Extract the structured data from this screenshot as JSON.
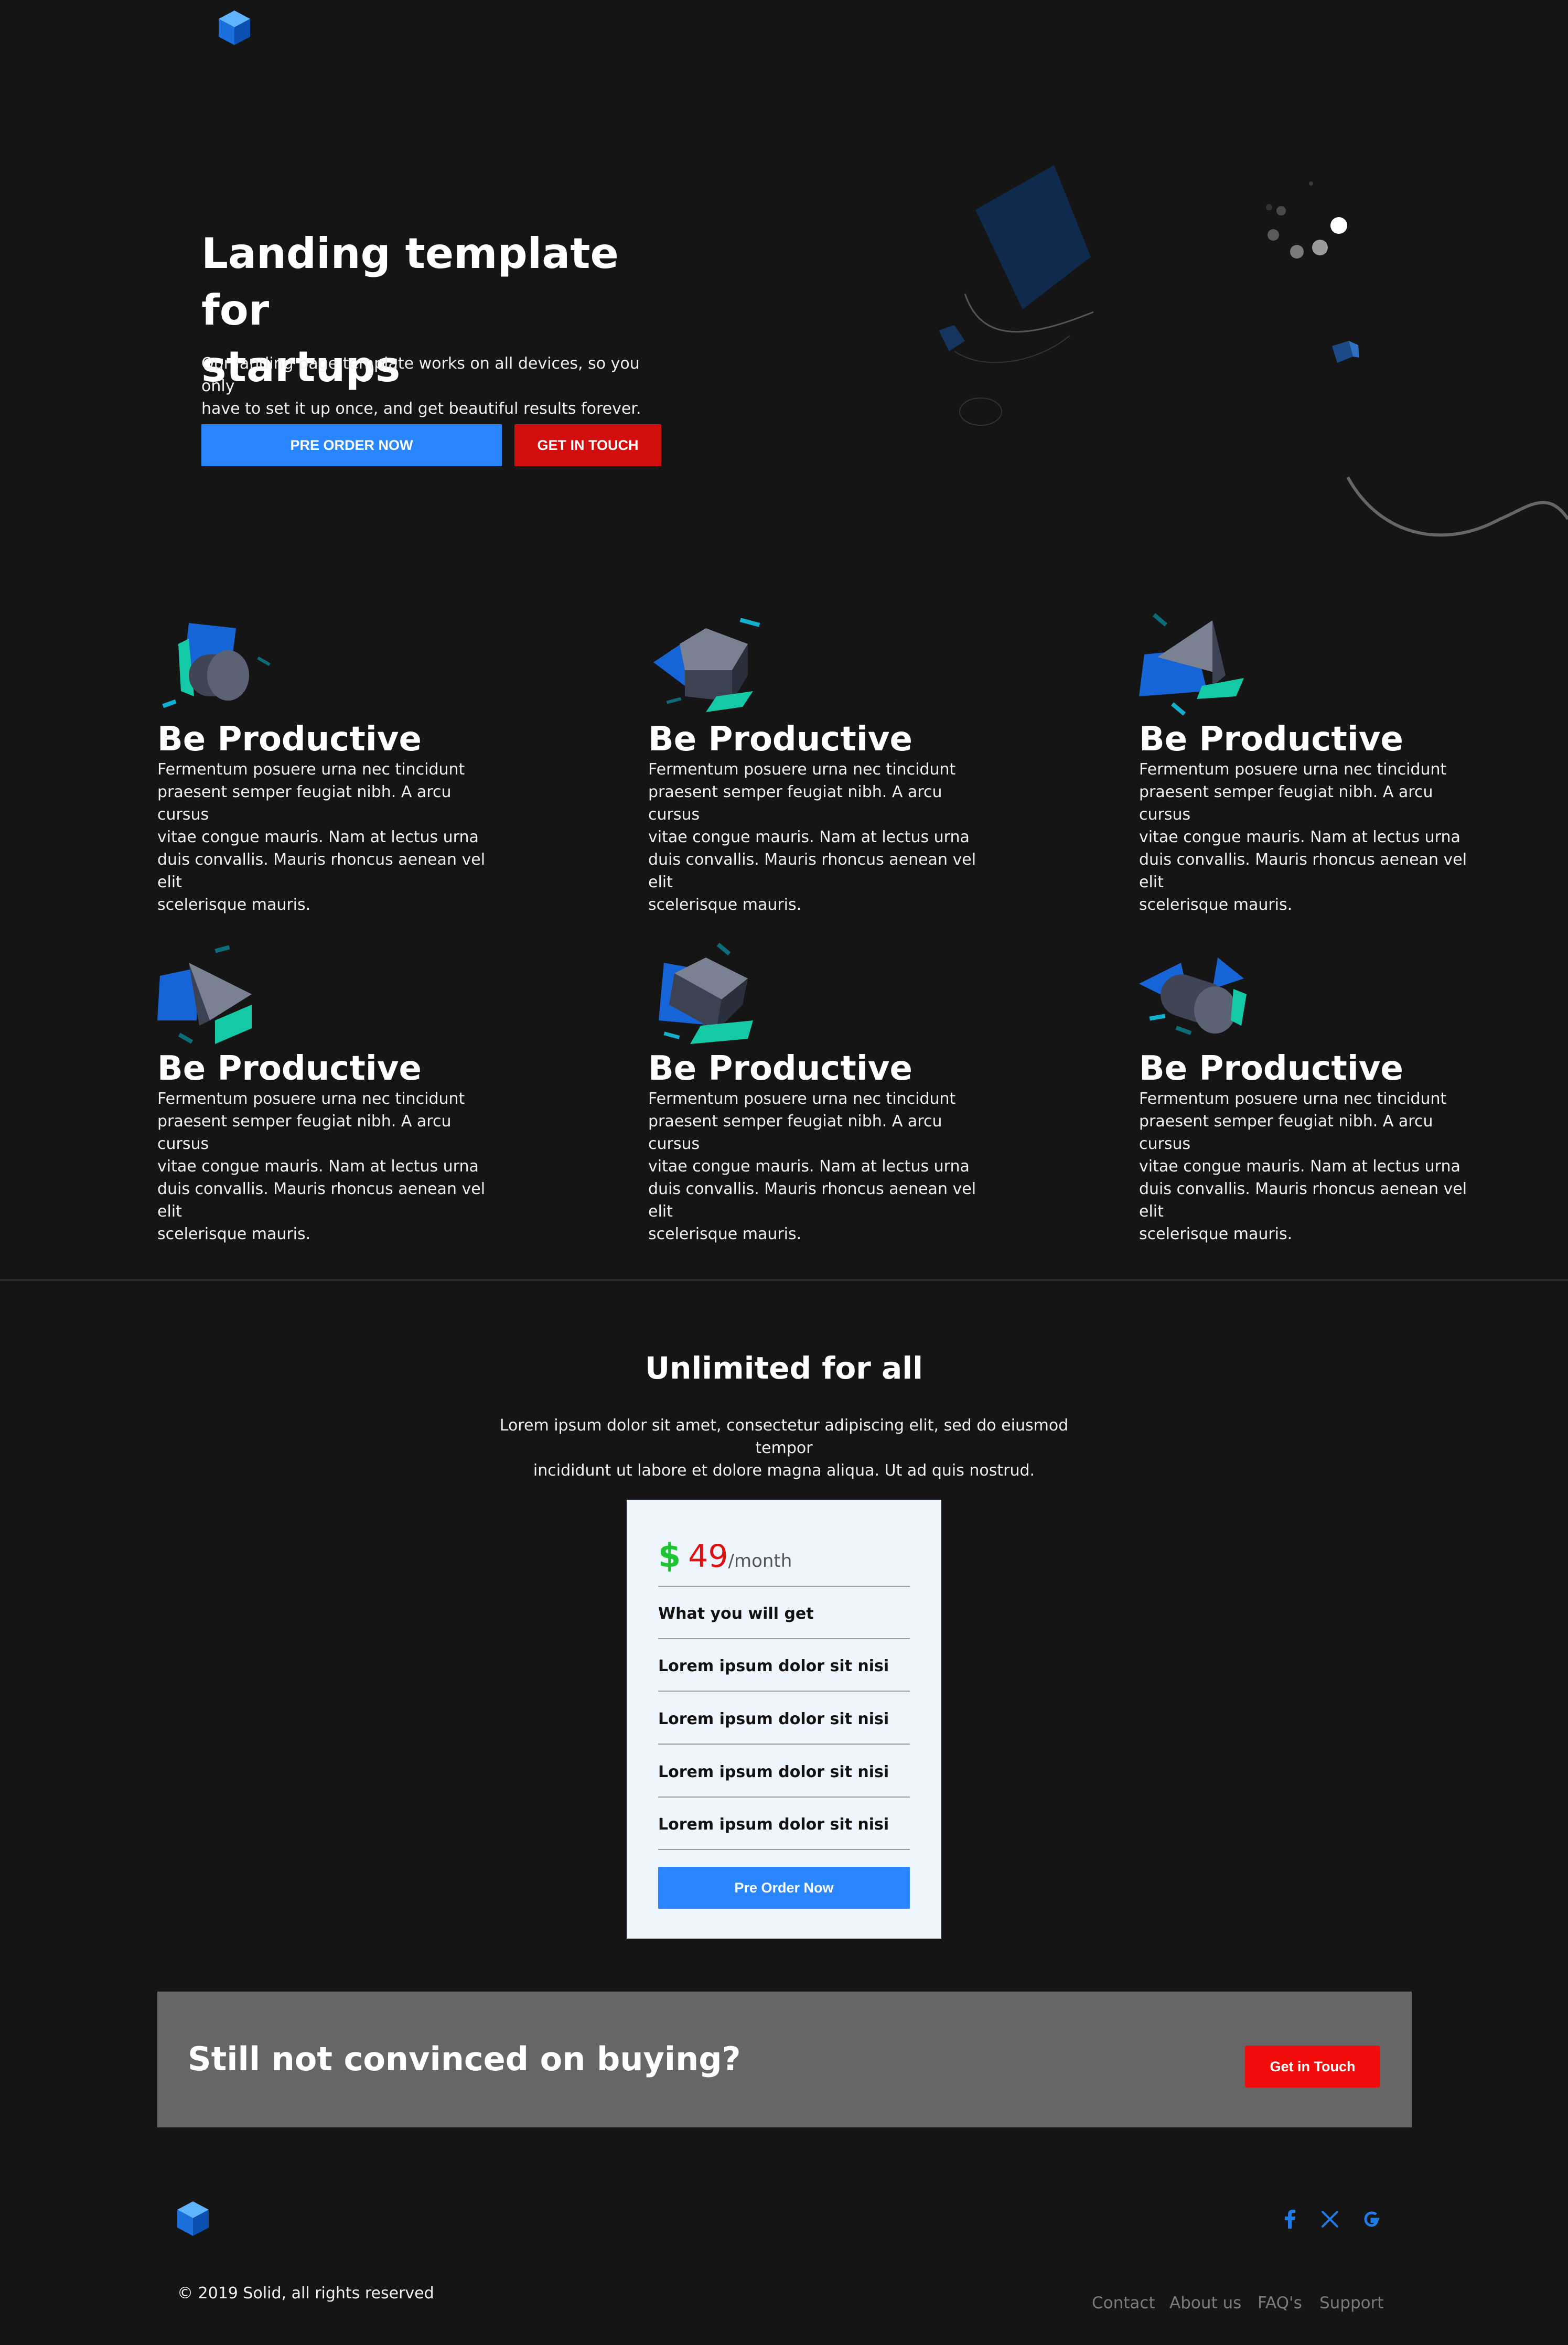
{
  "hero": {
    "title_line1": "Landing template for",
    "title_line2": "startups",
    "desc_line1": "Our landing page template works on all devices, so you only",
    "desc_line2": "have to set it up once, and get beautiful results forever.",
    "preorder_label": "PRE ORDER NOW",
    "touch_label": "GET IN TOUCH"
  },
  "features": [
    {
      "title": "Be Productive",
      "lines": [
        "Fermentum posuere urna nec tincidunt",
        "praesent semper feugiat nibh. A arcu cursus",
        "vitae congue mauris. Nam at lectus urna",
        "duis convallis. Mauris rhoncus aenean vel elit",
        "scelerisque mauris."
      ],
      "icon": "cylinder-icon"
    },
    {
      "title": "Be Productive",
      "lines": [
        "Fermentum posuere urna nec tincidunt",
        "praesent semper feugiat nibh. A arcu cursus",
        "vitae congue mauris. Nam at lectus urna",
        "duis convallis. Mauris rhoncus aenean vel elit",
        "scelerisque mauris."
      ],
      "icon": "cube-icon"
    },
    {
      "title": "Be Productive",
      "lines": [
        "Fermentum posuere urna nec tincidunt",
        "praesent semper feugiat nibh. A arcu cursus",
        "vitae congue mauris. Nam at lectus urna",
        "duis convallis. Mauris rhoncus aenean vel elit",
        "scelerisque mauris."
      ],
      "icon": "cone-icon"
    },
    {
      "title": "Be Productive",
      "lines": [
        "Fermentum posuere urna nec tincidunt",
        "praesent semper feugiat nibh. A arcu cursus",
        "vitae congue mauris. Nam at lectus urna",
        "duis convallis. Mauris rhoncus aenean vel elit",
        "scelerisque mauris."
      ],
      "icon": "pyramid-icon"
    },
    {
      "title": "Be Productive",
      "lines": [
        "Fermentum posuere urna nec tincidunt",
        "praesent semper feugiat nibh. A arcu cursus",
        "vitae congue mauris. Nam at lectus urna",
        "duis convallis. Mauris rhoncus aenean vel elit",
        "scelerisque mauris."
      ],
      "icon": "cube-icon"
    },
    {
      "title": "Be Productive",
      "lines": [
        "Fermentum posuere urna nec tincidunt",
        "praesent semper feugiat nibh. A arcu cursus",
        "vitae congue mauris. Nam at lectus urna",
        "duis convallis. Mauris rhoncus aenean vel elit",
        "scelerisque mauris."
      ],
      "icon": "cylinder-icon"
    }
  ],
  "pricing": {
    "title": "Unlimited for all",
    "desc_line1": "Lorem ipsum dolor sit amet, consectetur adipiscing elit, sed do eiusmod tempor",
    "desc_line2": "incididunt ut labore et dolore magna aliqua. Ut ad quis nostrud.",
    "currency": "$",
    "amount": "49",
    "period": "/month",
    "header": "What you will get",
    "items": [
      "Lorem ipsum dolor sit nisi",
      "Lorem ipsum dolor sit nisi",
      "Lorem ipsum dolor sit nisi",
      "Lorem ipsum dolor sit nisi"
    ],
    "button_label": "Pre Order Now"
  },
  "cta": {
    "title": "Still not convinced on buying?",
    "button_label": "Get in Touch"
  },
  "footer": {
    "copyright": "© 2019 Solid, all rights reserved",
    "links": [
      "Contact",
      "About us",
      "FAQ's",
      "Support"
    ],
    "social": [
      "facebook-icon",
      "x-icon",
      "google-icon"
    ]
  },
  "colors": {
    "background": "#151515",
    "primary": "#2a86ff",
    "danger": "#d10d0d",
    "card": "#eef5fd",
    "cta_bg": "#666666",
    "price_currency": "#1ec432",
    "price_amount": "#e01010"
  }
}
